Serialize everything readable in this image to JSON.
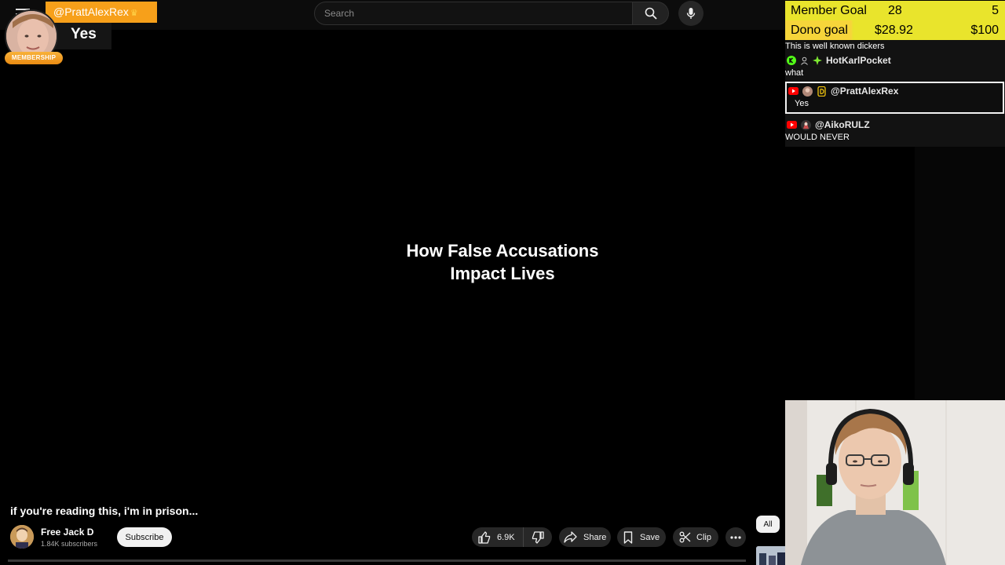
{
  "header": {
    "search_placeholder": "Search"
  },
  "highlight": {
    "username": "@PrattAlexRex",
    "message": "Yes",
    "badge": "MEMBERSHIP"
  },
  "video": {
    "center_text_line1": "How False Accusations",
    "center_text_line2": "Impact Lives",
    "title": "if you're reading this, i'm in prison...",
    "channel_name": "Free Jack D",
    "subscribers": "1.84K subscribers",
    "subscribe_label": "Subscribe",
    "likes": "6.9K",
    "share_label": "Share",
    "save_label": "Save",
    "clip_label": "Clip",
    "filter_chip": "All"
  },
  "goals": {
    "member": {
      "label": "Member Goal",
      "current": "28",
      "target": "5"
    },
    "dono": {
      "label": "Dono goal",
      "current": "$28.92",
      "target": "$100"
    }
  },
  "chat": {
    "messages": [
      {
        "user": "",
        "text": "This is well known dickers"
      },
      {
        "user": "HotKarlPocket",
        "text": "what"
      },
      {
        "user": "@PrattAlexRex",
        "text": "Yes"
      },
      {
        "user": "@AikoRULZ",
        "text": "WOULD NEVER"
      }
    ]
  },
  "colors": {
    "highlight_orange": "#f7a01a",
    "goal_yellow": "#e9e42c",
    "youtube_red": "#ff0000",
    "kick_green": "#53fc18"
  }
}
